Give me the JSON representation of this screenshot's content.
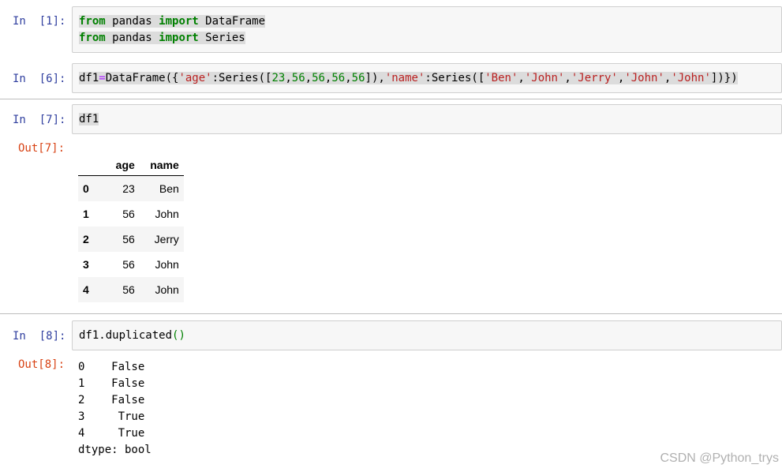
{
  "cells": {
    "c1": {
      "prompt": "In  [1]:",
      "line1": {
        "kw1": "from",
        "mod": " pandas ",
        "kw2": "import",
        "name": " DataFrame"
      },
      "line2": {
        "kw1": "from",
        "mod": " pandas ",
        "kw2": "import",
        "name": " Series"
      }
    },
    "c6": {
      "prompt": "In  [6]:",
      "t1": "df1",
      "t2": "=",
      "t3": "DataFrame({",
      "t4": "'age'",
      "t5": ":Series([",
      "n1": "23",
      "c1": ",",
      "n2": "56",
      "c2": ",",
      "n3": "56",
      "c3": ",",
      "n4": "56",
      "c4": ",",
      "n5": "56",
      "t6": "]),",
      "t7": "'name'",
      "t8": ":Series([",
      "s1": "'Ben'",
      "d1": ",",
      "s2": "'John'",
      "d2": ",",
      "s3": "'Jerry'",
      "d3": ",",
      "s4": "'John'",
      "d4": ",",
      "s5": "'John'",
      "t9": "])})"
    },
    "c7": {
      "prompt": "In  [7]:",
      "code": "df1",
      "out_prompt": "Out[7]:",
      "table": {
        "columns": [
          "",
          "age",
          "name"
        ],
        "rows": [
          {
            "index": "0",
            "age": "23",
            "name": "Ben"
          },
          {
            "index": "1",
            "age": "56",
            "name": "John"
          },
          {
            "index": "2",
            "age": "56",
            "name": "Jerry"
          },
          {
            "index": "3",
            "age": "56",
            "name": "John"
          },
          {
            "index": "4",
            "age": "56",
            "name": "John"
          }
        ]
      }
    },
    "c8": {
      "prompt": "In  [8]:",
      "code_a": "df1.duplicated",
      "code_b": "()",
      "out_prompt": "Out[8]:",
      "output": "0    False\n1    False\n2    False\n3     True\n4     True\ndtype: bool"
    }
  },
  "watermark": "CSDN @Python_trys",
  "colors": {
    "in_prompt": "#303f9f",
    "out_prompt": "#d84315",
    "keyword": "#008000",
    "string": "#ba2121"
  }
}
